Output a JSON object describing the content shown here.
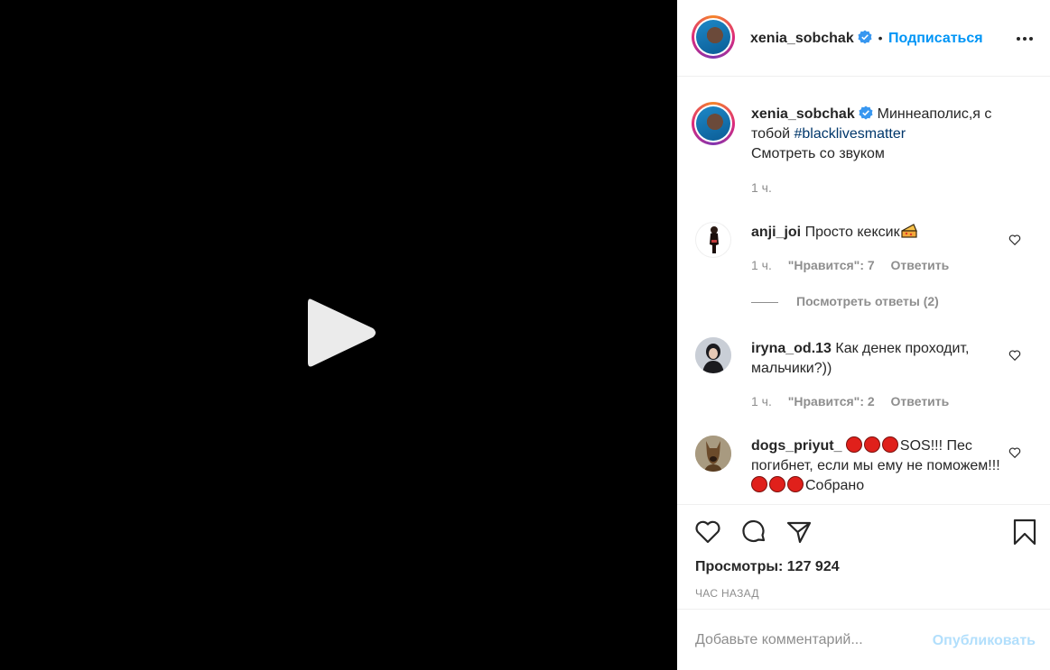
{
  "video": {
    "play_icon": "play-icon"
  },
  "header": {
    "username": "xenia_sobchak",
    "separator": "•",
    "follow_label": "Подписаться",
    "more_icon": "more-dots-icon"
  },
  "caption": {
    "username": "xenia_sobchak",
    "text_before": "Миннеаполис,я с тобой ",
    "hashtag": "#blacklivesmatter",
    "line2": "Смотреть со звуком",
    "time": "1 ч."
  },
  "comments": [
    {
      "username": "anji_joi",
      "text": "Просто кексик",
      "time": "1 ч.",
      "likes": "\"Нравится\": 7",
      "reply": "Ответить"
    },
    {
      "username": "iryna_od.13",
      "text": "Как денек проходит, мальчики?))",
      "time": "1 ч.",
      "likes": "\"Нравится\": 2",
      "reply": "Ответить"
    },
    {
      "username": "dogs_priyut_",
      "text_a": "SOS!!! Пес погибнет, если мы ему не поможем!!!",
      "text_b": "Собрано"
    }
  ],
  "view_replies": "Посмотреть ответы (2)",
  "stats": {
    "views": "Просмотры: 127 924",
    "time_ago": "ЧАС НАЗАД"
  },
  "add_comment": {
    "placeholder": "Добавьте комментарий...",
    "publish_label": "Опубликовать"
  },
  "colors": {
    "accent": "#0095f6",
    "muted": "#8e8e8e",
    "publish_disabled": "#b2dffc"
  }
}
